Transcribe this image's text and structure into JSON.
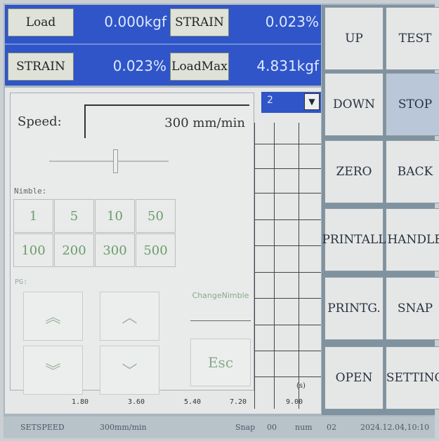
{
  "readouts": [
    {
      "label": "Load",
      "value": "0.000kgf"
    },
    {
      "label": "STRAIN",
      "value": "0.023%"
    },
    {
      "label": "STRAIN",
      "value": "0.023%"
    },
    {
      "label": "LoadMax",
      "value": "4.831kgf"
    }
  ],
  "buttons": [
    {
      "label": "UP"
    },
    {
      "label": "TEST"
    },
    {
      "label": "DOWN"
    },
    {
      "label": "STOP"
    },
    {
      "label": "ZERO"
    },
    {
      "label": "BACK"
    },
    {
      "label": "PRINTALL"
    },
    {
      "label": "HANDLE"
    },
    {
      "label": "PRINTG."
    },
    {
      "label": "SNAP"
    },
    {
      "label": "OPEN"
    },
    {
      "label": "SETTING"
    }
  ],
  "chart": {
    "combo_value": "2",
    "x_ticks": [
      "1.80",
      "3.60",
      "5.40",
      "7.20",
      "9.00"
    ],
    "x_unit": "(s)"
  },
  "dialog": {
    "speed_label": "Speed:",
    "speed_value": "300 mm/min",
    "nimble_label": "Nimble:",
    "nimble_values": [
      "1",
      "5",
      "10",
      "50",
      "100",
      "200",
      "300",
      "500"
    ],
    "pg_label": "PG:",
    "change_nimble": "ChangeNimble",
    "esc": "Esc"
  },
  "status": {
    "setspeed_label": "SETSPEED",
    "setspeed_value": "300mm/min",
    "snap_label": "Snap",
    "snap_value": "00",
    "num_label": "num",
    "num_value": "02",
    "datetime": "2024.12.04,10:10"
  }
}
